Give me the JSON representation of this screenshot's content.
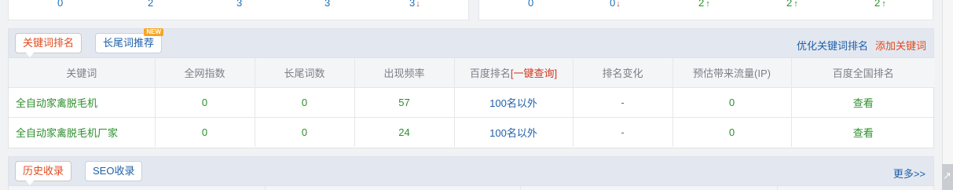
{
  "top_stats_left": [
    {
      "value": "0",
      "trend": ""
    },
    {
      "value": "2",
      "trend": ""
    },
    {
      "value": "3",
      "trend": ""
    },
    {
      "value": "3",
      "trend": ""
    },
    {
      "value": "3",
      "trend": "down"
    }
  ],
  "top_stats_right": [
    {
      "value": "0",
      "trend": ""
    },
    {
      "value": "0",
      "trend": "down"
    },
    {
      "value": "2",
      "trend": "up"
    },
    {
      "value": "2",
      "trend": "up"
    },
    {
      "value": "2",
      "trend": "up"
    }
  ],
  "keyword_panel": {
    "tab_ranking": "关键词排名",
    "tab_longtail": "长尾词推荐",
    "new_badge": "NEW",
    "link_optimize": "优化关键词排名",
    "link_add": "添加关键词",
    "columns": {
      "keyword": "关键词",
      "network_index": "全网指数",
      "longtail_count": "长尾词数",
      "frequency": "出现频率",
      "baidu_rank_prefix": "百度排名",
      "baidu_rank_query": "[一键查询]",
      "rank_change": "排名变化",
      "est_traffic": "预估带来流量(IP)",
      "baidu_national": "百度全国排名"
    },
    "rows": [
      {
        "keyword": "全自动家禽脱毛机",
        "index": "0",
        "longtail": "0",
        "freq": "57",
        "rank": "100名以外",
        "change": "-",
        "traffic": "0",
        "national": "查看"
      },
      {
        "keyword": "全自动家禽脱毛机厂家",
        "index": "0",
        "longtail": "0",
        "freq": "24",
        "rank": "100名以外",
        "change": "-",
        "traffic": "0",
        "national": "查看"
      }
    ]
  },
  "history_panel": {
    "tab_history": "历史收录",
    "tab_seo": "SEO收录",
    "more_link": "更多>>"
  },
  "colors": {
    "accent_blue": "#1f5fa8",
    "accent_orange": "#e2491d",
    "value_green": "#2c8e2c",
    "down_red": "#d1322c"
  }
}
